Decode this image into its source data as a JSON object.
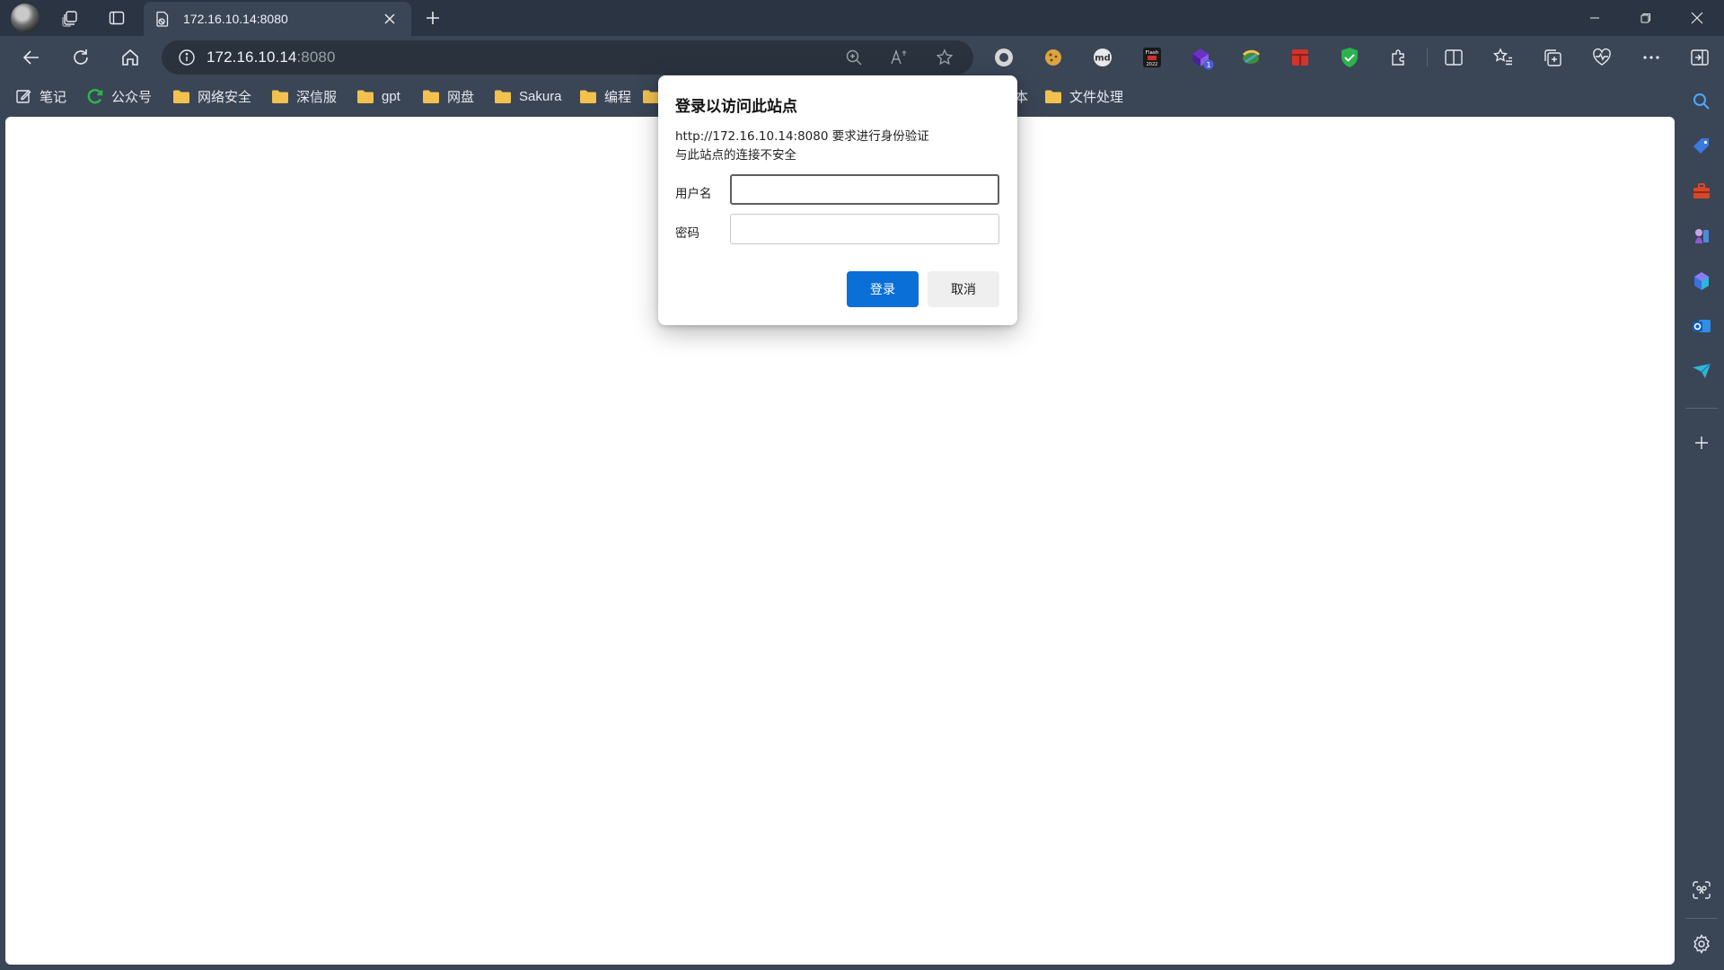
{
  "tab": {
    "title": "172.16.10.14:8080"
  },
  "address_bar": {
    "host": "172.16.10.14",
    "port": ":8080"
  },
  "bookmarks": [
    {
      "label": "笔记",
      "icon": "note-edit-icon"
    },
    {
      "label": "公众号",
      "icon": "wechat-refresh-icon"
    },
    {
      "label": "网络安全",
      "icon": "folder-icon"
    },
    {
      "label": "深信服",
      "icon": "folder-icon"
    },
    {
      "label": "gpt",
      "icon": "folder-icon"
    },
    {
      "label": "网盘",
      "icon": "folder-icon"
    },
    {
      "label": "Sakura",
      "icon": "folder-icon"
    },
    {
      "label": "编程",
      "icon": "folder-icon"
    },
    {
      "label": "本",
      "icon": ""
    },
    {
      "label": "文件处理",
      "icon": "folder-icon"
    }
  ],
  "extensions": {
    "flash_badge_line1": "Flash",
    "flash_badge_line2": "2022",
    "md_label": "md",
    "badge_count": "1"
  },
  "dialog": {
    "title": "登录以访问此站点",
    "line1": "http://172.16.10.14:8080 要求进行身份验证",
    "line2": "与此站点的连接不安全",
    "username_label": "用户名",
    "username_value": "",
    "password_label": "密码",
    "password_value": "",
    "login_button": "登录",
    "cancel_button": "取消"
  },
  "colors": {
    "frame": "#3a4556",
    "tabstrip": "#2b3442",
    "primary_button": "#0a6fd6",
    "folder": "#f2c14e"
  }
}
